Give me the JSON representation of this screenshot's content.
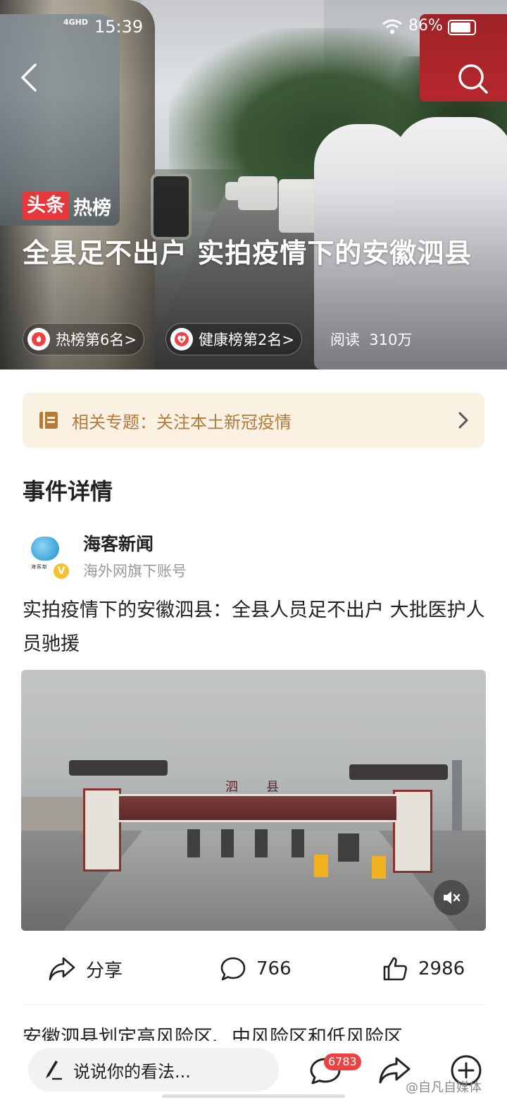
{
  "status_bar": {
    "network": "4GHD",
    "time": "15:39",
    "battery": "86%"
  },
  "hero": {
    "badge_left": "头条",
    "badge_right": "热榜",
    "title": "全县足不出户  实拍疫情下的安徽泗县",
    "hot_rank": "热榜第6名>",
    "health_rank": "健康榜第2名>",
    "reads_label": "阅读",
    "reads_value": "310万"
  },
  "topic": {
    "label": "相关专题：关注本土新冠疫情"
  },
  "section": {
    "title": "事件详情"
  },
  "author": {
    "name": "海客新闻",
    "subtitle": "海外网旗下账号",
    "logo_text": "海客新"
  },
  "article": {
    "title": "实拍疫情下的安徽泗县：全县人员足不出户  大批医护人员驰援"
  },
  "photo": {
    "sign_text": "泗县"
  },
  "actions": {
    "share": "分享",
    "comments": "766",
    "likes": "2986"
  },
  "next_article": {
    "title": "安徽泗县划定高风险区、中风险区和低风险区"
  },
  "bottom_bar": {
    "comment_placeholder": "说说你的看法...",
    "comment_count": "6783"
  },
  "watermark": "@自凡自媒体",
  "colors": {
    "accent_red": "#e8373a",
    "topic_bg": "#fbf1e3",
    "topic_text": "#b27a3b",
    "badge_red": "#f04142"
  }
}
